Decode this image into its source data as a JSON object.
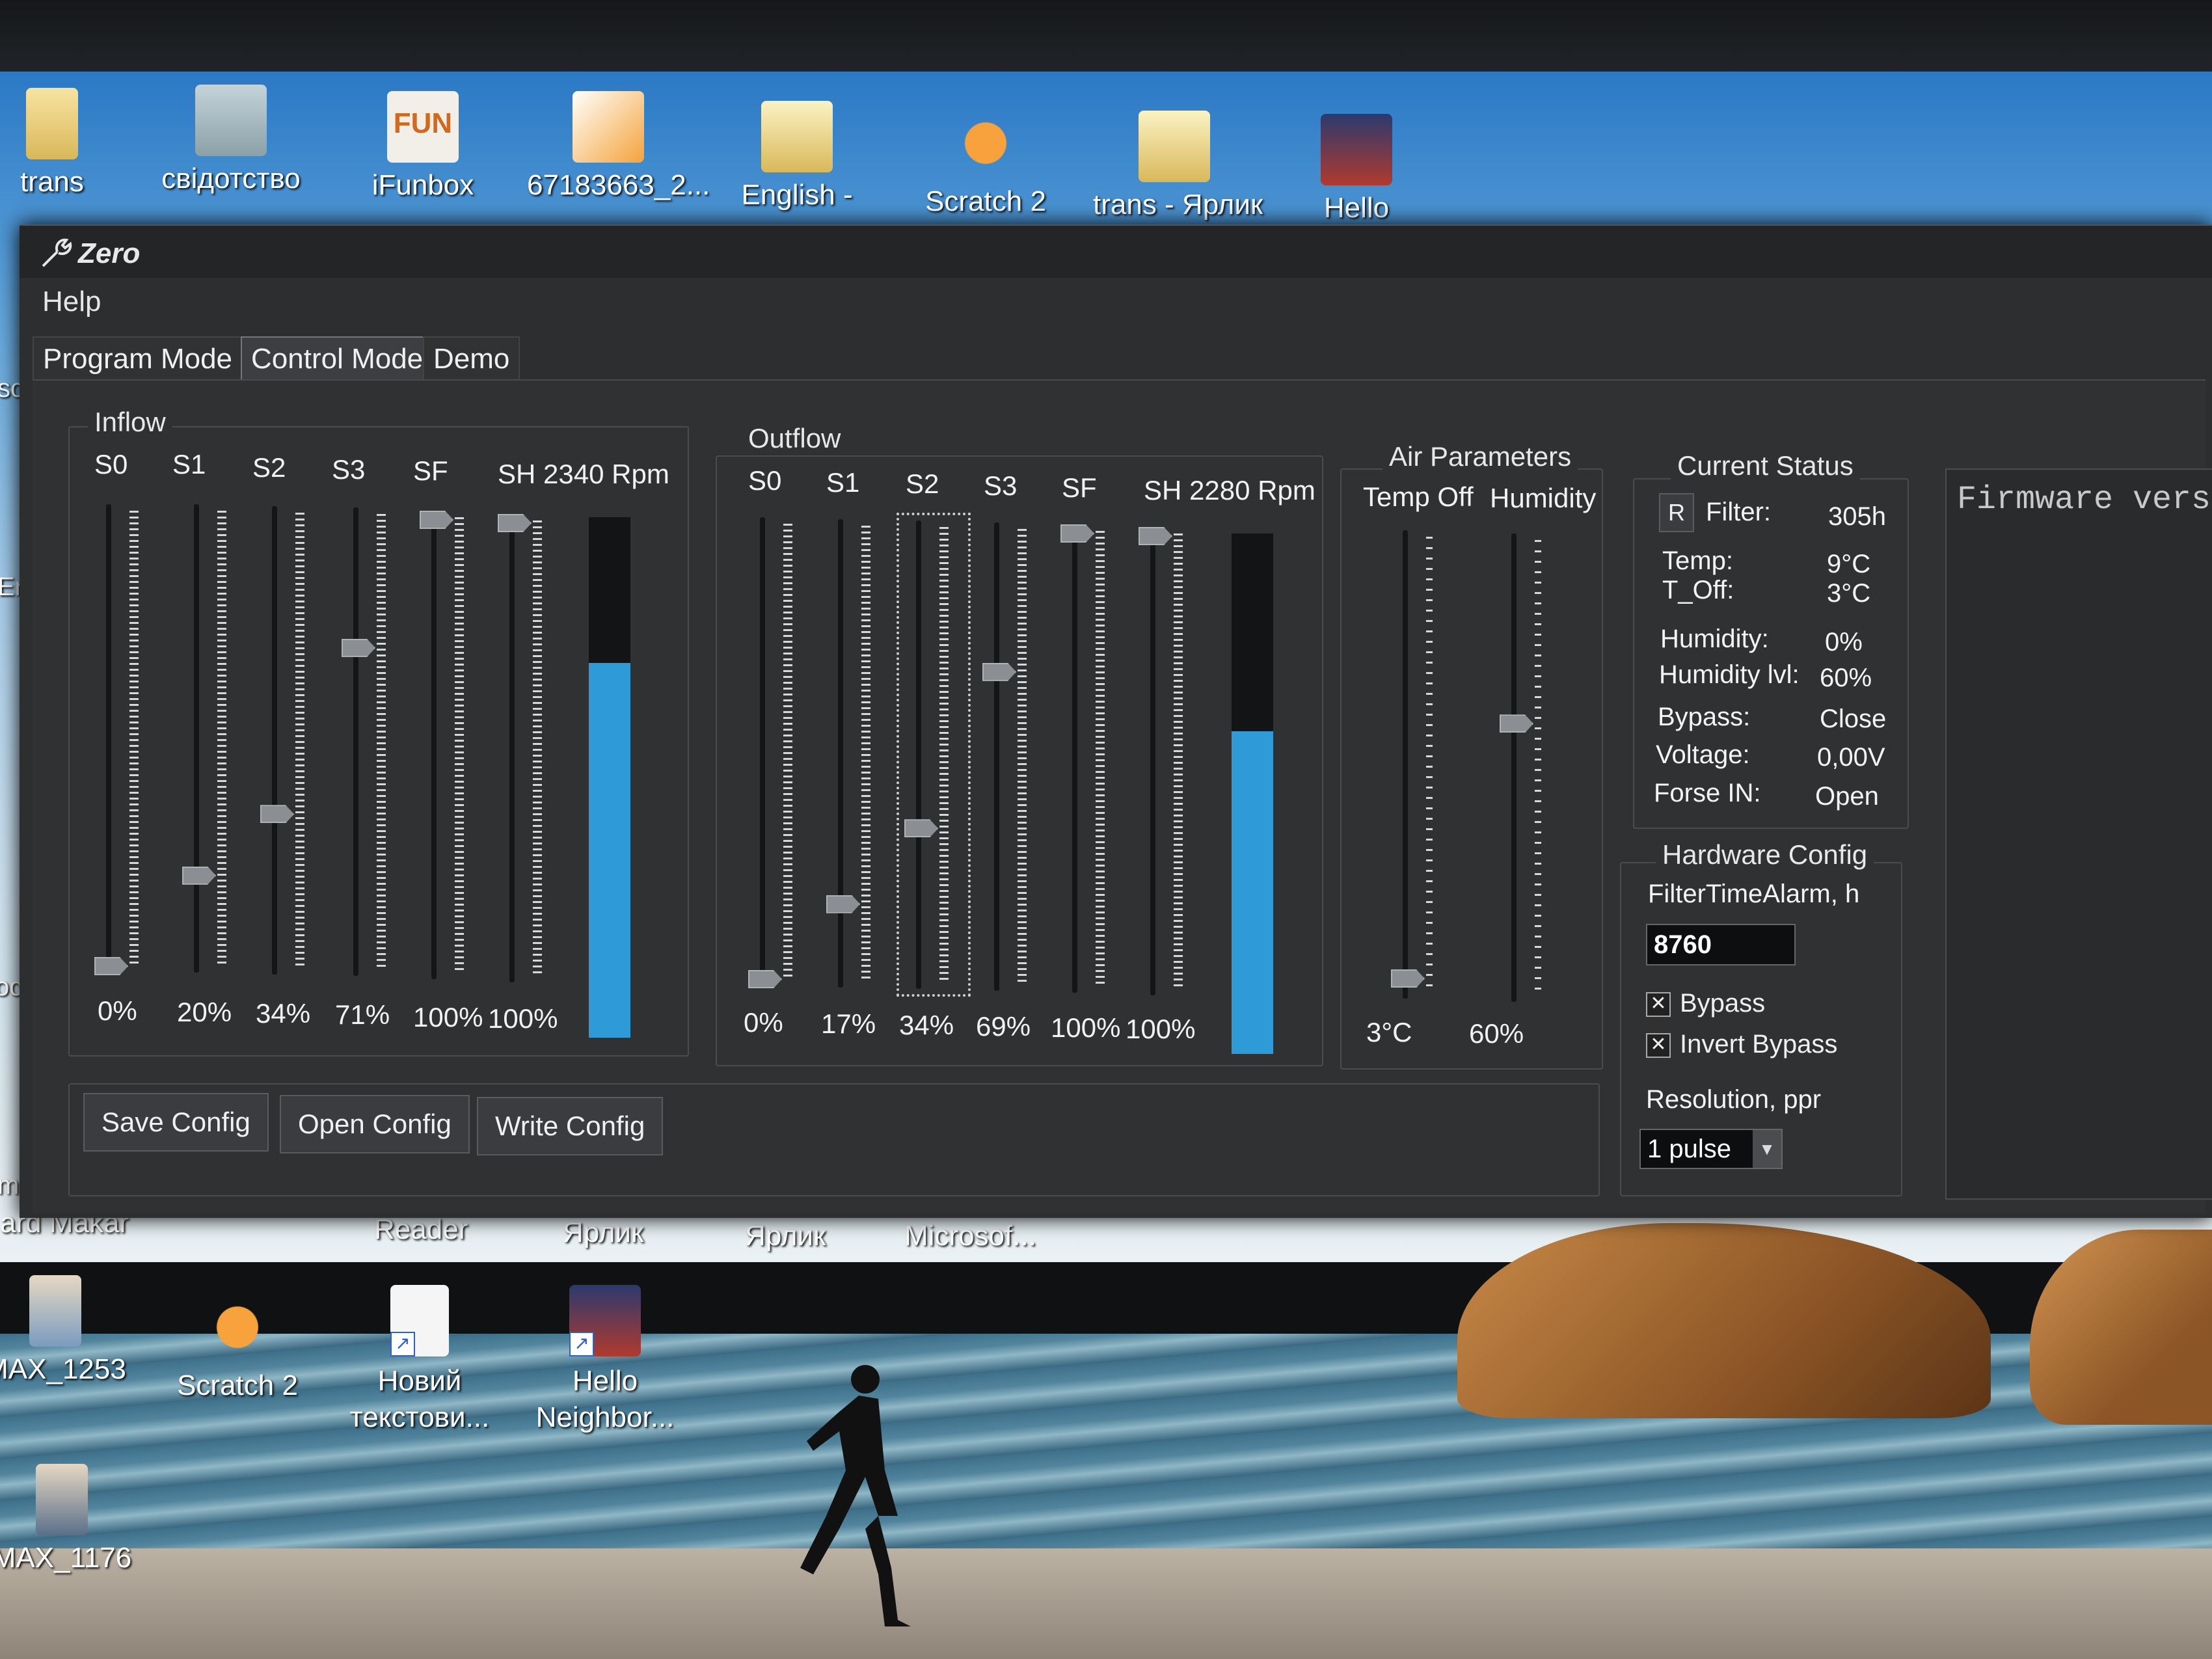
{
  "desktop": {
    "top_icons": [
      {
        "label": "trans"
      },
      {
        "label": "свідотство"
      },
      {
        "label": "iFunbox"
      },
      {
        "label": "67183663_2..."
      },
      {
        "label": "English -"
      },
      {
        "label": "Scratch 2"
      },
      {
        "label": "trans - Ярлик"
      },
      {
        "label": "Hello"
      }
    ],
    "bottom_label_row": [
      "ard Makar",
      "Reader",
      "Ярлик",
      "Ярлик",
      "Microsof..."
    ],
    "bottom_icons": [
      {
        "label": "MAX_1253"
      },
      {
        "label": "Scratch 2"
      },
      {
        "label": "Новий текстови..."
      },
      {
        "label": "Hello Neighbor..."
      },
      {
        "label": "MAX_1176"
      }
    ],
    "fun_icon_text": "FUN",
    "left_edge_fragments": [
      "sc",
      "Er",
      "oc",
      "m"
    ]
  },
  "window": {
    "title": "Zero",
    "menu": {
      "help": "Help"
    },
    "tabs": [
      {
        "label": "Program Mode",
        "active": false
      },
      {
        "label": "Control Mode",
        "active": true
      },
      {
        "label": "Demo",
        "active": false
      }
    ]
  },
  "inflow": {
    "title": "Inflow",
    "sliders": [
      {
        "label": "S0",
        "percent": 0,
        "value_label": "0%"
      },
      {
        "label": "S1",
        "percent": 20,
        "value_label": "20%"
      },
      {
        "label": "S2",
        "percent": 34,
        "value_label": "34%"
      },
      {
        "label": "S3",
        "percent": 71,
        "value_label": "71%"
      },
      {
        "label": "SF",
        "percent": 100,
        "value_label": "100%"
      },
      {
        "label": "SH",
        "percent": 100,
        "value_label": "100%"
      }
    ],
    "rpm_label": "2340 Rpm",
    "level_percent": 72
  },
  "outflow": {
    "title": "Outflow",
    "sliders": [
      {
        "label": "S0",
        "percent": 0,
        "value_label": "0%"
      },
      {
        "label": "S1",
        "percent": 17,
        "value_label": "17%"
      },
      {
        "label": "S2",
        "percent": 34,
        "value_label": "34%"
      },
      {
        "label": "S3",
        "percent": 69,
        "value_label": "69%"
      },
      {
        "label": "SF",
        "percent": 100,
        "value_label": "100%"
      },
      {
        "label": "SH",
        "percent": 100,
        "value_label": "100%"
      }
    ],
    "rpm_label": "2280 Rpm",
    "level_percent": 62
  },
  "air_parameters": {
    "title": "Air Parameters",
    "temp_off": {
      "label": "Temp Off",
      "value_label": "3°C",
      "percent": 3
    },
    "humidity": {
      "label": "Humidity",
      "value_label": "60%",
      "percent": 60
    }
  },
  "current_status": {
    "title": "Current Status",
    "reset_label": "R",
    "rows": [
      {
        "key": "Filter:",
        "value": "305h"
      },
      {
        "key": "Temp:",
        "value": "9°C"
      },
      {
        "key": "T_Off:",
        "value": "3°C"
      },
      {
        "key": "Humidity:",
        "value": "0%"
      },
      {
        "key": "Humidity lvl:",
        "value": "60%"
      },
      {
        "key": "Bypass:",
        "value": "Close"
      },
      {
        "key": "Voltage:",
        "value": "0,00V"
      },
      {
        "key": "Forse IN:",
        "value": "Open"
      }
    ]
  },
  "hardware_config": {
    "title": "Hardware Config",
    "filter_alarm_label": "FilterTimeAlarm, h",
    "filter_alarm_value": "8760",
    "checks": [
      {
        "label": "Bypass",
        "checked": true
      },
      {
        "label": "Invert Bypass",
        "checked": true
      }
    ],
    "check_mark": "✕",
    "resolution_label": "Resolution, ppr",
    "resolution_value": "1 pulse"
  },
  "buttons": {
    "save": "Save Config",
    "open": "Open Config",
    "write": "Write Config"
  },
  "firmware": {
    "text": "Firmware vers"
  },
  "colors": {
    "accent_bar": "#2e9ad8"
  }
}
